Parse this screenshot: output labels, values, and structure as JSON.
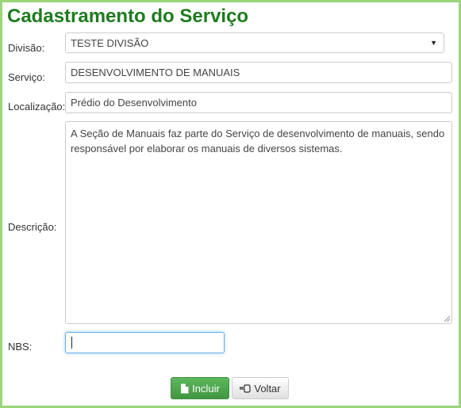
{
  "page": {
    "title": "Cadastramento do Serviço"
  },
  "form": {
    "divisao": {
      "label": "Divisão:",
      "value": "TESTE DIVISÃO"
    },
    "servico": {
      "label": "Serviço:",
      "value": "DESENVOLVIMENTO DE MANUAIS"
    },
    "localizacao": {
      "label": "Localização:",
      "value": "Prédio do Desenvolvimento"
    },
    "descricao": {
      "label": "Descrição:",
      "value": "A Seção de Manuais faz parte do Serviço de desenvolvimento de manuais, sendo responsável por elaborar os manuais de diversos sistemas."
    },
    "nbs": {
      "label": "NBS:",
      "value": ""
    }
  },
  "actions": {
    "incluir": {
      "label": "Incluir",
      "icon": "document-icon",
      "color": "#5cb85c"
    },
    "voltar": {
      "label": "Voltar",
      "icon": "hand-pointing-left-icon"
    }
  }
}
